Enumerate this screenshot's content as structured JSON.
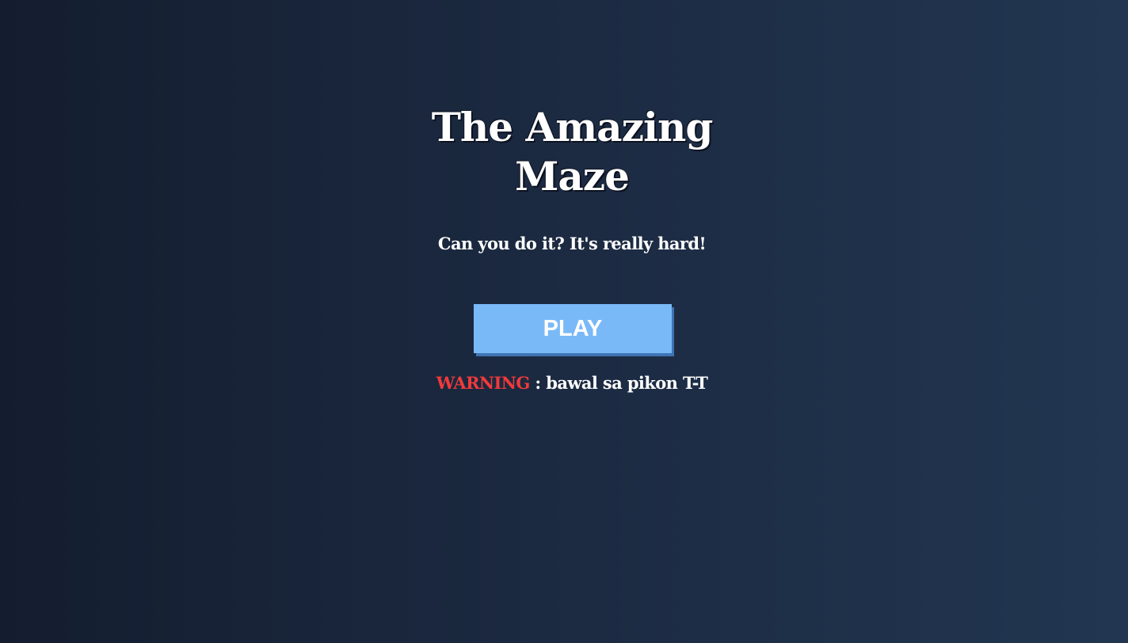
{
  "menu": {
    "title_line1": "The Amazing",
    "title_line2": "Maze",
    "subtitle": "Can you do it? It's really hard!",
    "play_label": "PLAY",
    "warning_label": "WARNING",
    "warning_text": " : bawal sa pikon T-T"
  },
  "colors": {
    "background_left": "#141d2f",
    "background_right": "#223651",
    "play_button": "#7ab9f8",
    "play_button_shadow": "#3f74b3",
    "warning_label": "#f03a3a",
    "text": "#ffffff"
  }
}
